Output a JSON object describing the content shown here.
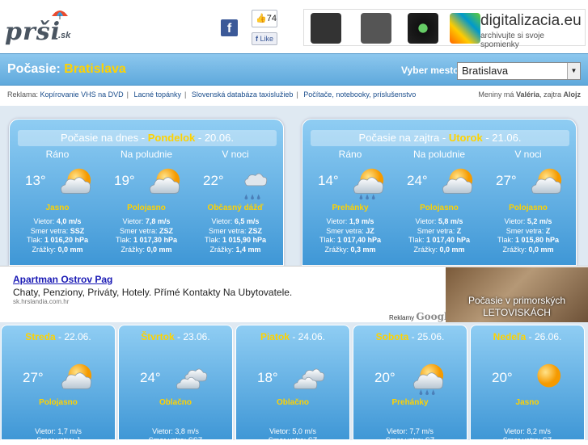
{
  "header": {
    "logo_text": "prši",
    "logo_sk": ".sk",
    "fb_icon": "f",
    "like_count": "74",
    "like_label": "Like",
    "banner_title": "digitalizacia.eu",
    "banner_sub": "archivujte si svoje spomienky"
  },
  "title": {
    "prefix": "Počasie:",
    "city": "Bratislava",
    "select_label": "Vyber mesto",
    "select_value": "Bratislava"
  },
  "adbar": {
    "prefix": "Reklama:",
    "links": [
      "Kopírovanie VHS na DVD",
      "Lacné topánky",
      "Slovenská databáza taxislužieb",
      "Počítače, notebooky, príslušenstvo"
    ],
    "meniny_prefix": "Meniny má",
    "meniny_today": "Valéria",
    "meniny_mid": ", zajtra",
    "meniny_tomorrow": "Alojz"
  },
  "today": {
    "head_prefix": "Počasie na dnes -",
    "day": "Pondelok",
    "date": "- 20.06.",
    "cols": [
      {
        "label": "Ráno",
        "temp": "13°",
        "icon": "partly-cloudy-icon",
        "cond": "Jasno",
        "wind": "4,0 m/s",
        "dir": "SSZ",
        "press": "1 016,20 hPa",
        "rain": "0,0 mm"
      },
      {
        "label": "Na poludnie",
        "temp": "19°",
        "icon": "partly-cloudy-icon",
        "cond": "Polojasno",
        "wind": "7,8 m/s",
        "dir": "ZSZ",
        "press": "1 017,30 hPa",
        "rain": "0,0 mm"
      },
      {
        "label": "V noci",
        "temp": "22°",
        "icon": "rain-cloud-icon",
        "cond": "Občasný dážď",
        "wind": "6,5 m/s",
        "dir": "ZSZ",
        "press": "1 015,90 hPa",
        "rain": "1,4 mm"
      }
    ]
  },
  "tomorrow": {
    "head_prefix": "Počasie na zajtra -",
    "day": "Utorok",
    "date": "- 21.06.",
    "cols": [
      {
        "label": "Ráno",
        "temp": "14°",
        "icon": "showers-icon",
        "cond": "Prehánky",
        "wind": "1,9 m/s",
        "dir": "JZ",
        "press": "1 017,40 hPa",
        "rain": "0,3 mm"
      },
      {
        "label": "Na poludnie",
        "temp": "24°",
        "icon": "partly-cloudy-icon",
        "cond": "Polojasno",
        "wind": "5,8 m/s",
        "dir": "Z",
        "press": "1 017,40 hPa",
        "rain": "0,0 mm"
      },
      {
        "label": "V noci",
        "temp": "27°",
        "icon": "partly-cloudy-icon",
        "cond": "Polojasno",
        "wind": "5,2 m/s",
        "dir": "Z",
        "press": "1 015,80 hPa",
        "rain": "0,0 mm"
      }
    ]
  },
  "det_labels": {
    "wind": "Vietor:",
    "dir": "Smer vetra:",
    "press": "Tlak:",
    "rain": "Zrážky:"
  },
  "ad": {
    "title": "Apartman Ostrov Pag",
    "text": "Chaty, Penziony, Priváty, Hotely. Přímé Kontakty Na Ubytovatele.",
    "url": "sk.hrslandia.com.hr",
    "gl_prefix": "Reklamy",
    "gl_brand": "Google",
    "img_caption1": "Počasie v primorských",
    "img_caption2": "LETOVISKÁCH"
  },
  "week": [
    {
      "day": "Streda",
      "date": "- 22.06.",
      "temp": "27°",
      "icon": "partly-cloudy-icon",
      "cond": "Polojasno",
      "wind": "Vietor: 1,7 m/s",
      "dir": "Smer vetra: J"
    },
    {
      "day": "Štvrtok",
      "date": "- 23.06.",
      "temp": "24°",
      "icon": "cloudy-icon",
      "cond": "Oblačno",
      "wind": "Vietor: 3,8 m/s",
      "dir": "Smer vetra: SSZ"
    },
    {
      "day": "Piatok",
      "date": "- 24.06.",
      "temp": "18°",
      "icon": "cloudy-icon",
      "cond": "Oblačno",
      "wind": "Vietor: 5,0 m/s",
      "dir": "Smer vetra: SZ"
    },
    {
      "day": "Sobota",
      "date": "- 25.06.",
      "temp": "20°",
      "icon": "showers-icon",
      "cond": "Prehánky",
      "wind": "Vietor: 7,7 m/s",
      "dir": "Smer vetra: SZ"
    },
    {
      "day": "Nedeľa",
      "date": "- 26.06.",
      "temp": "20°",
      "icon": "sun-icon",
      "cond": "Jasno",
      "wind": "Vietor: 8,2 m/s",
      "dir": "Smer vetra: SZ"
    }
  ]
}
